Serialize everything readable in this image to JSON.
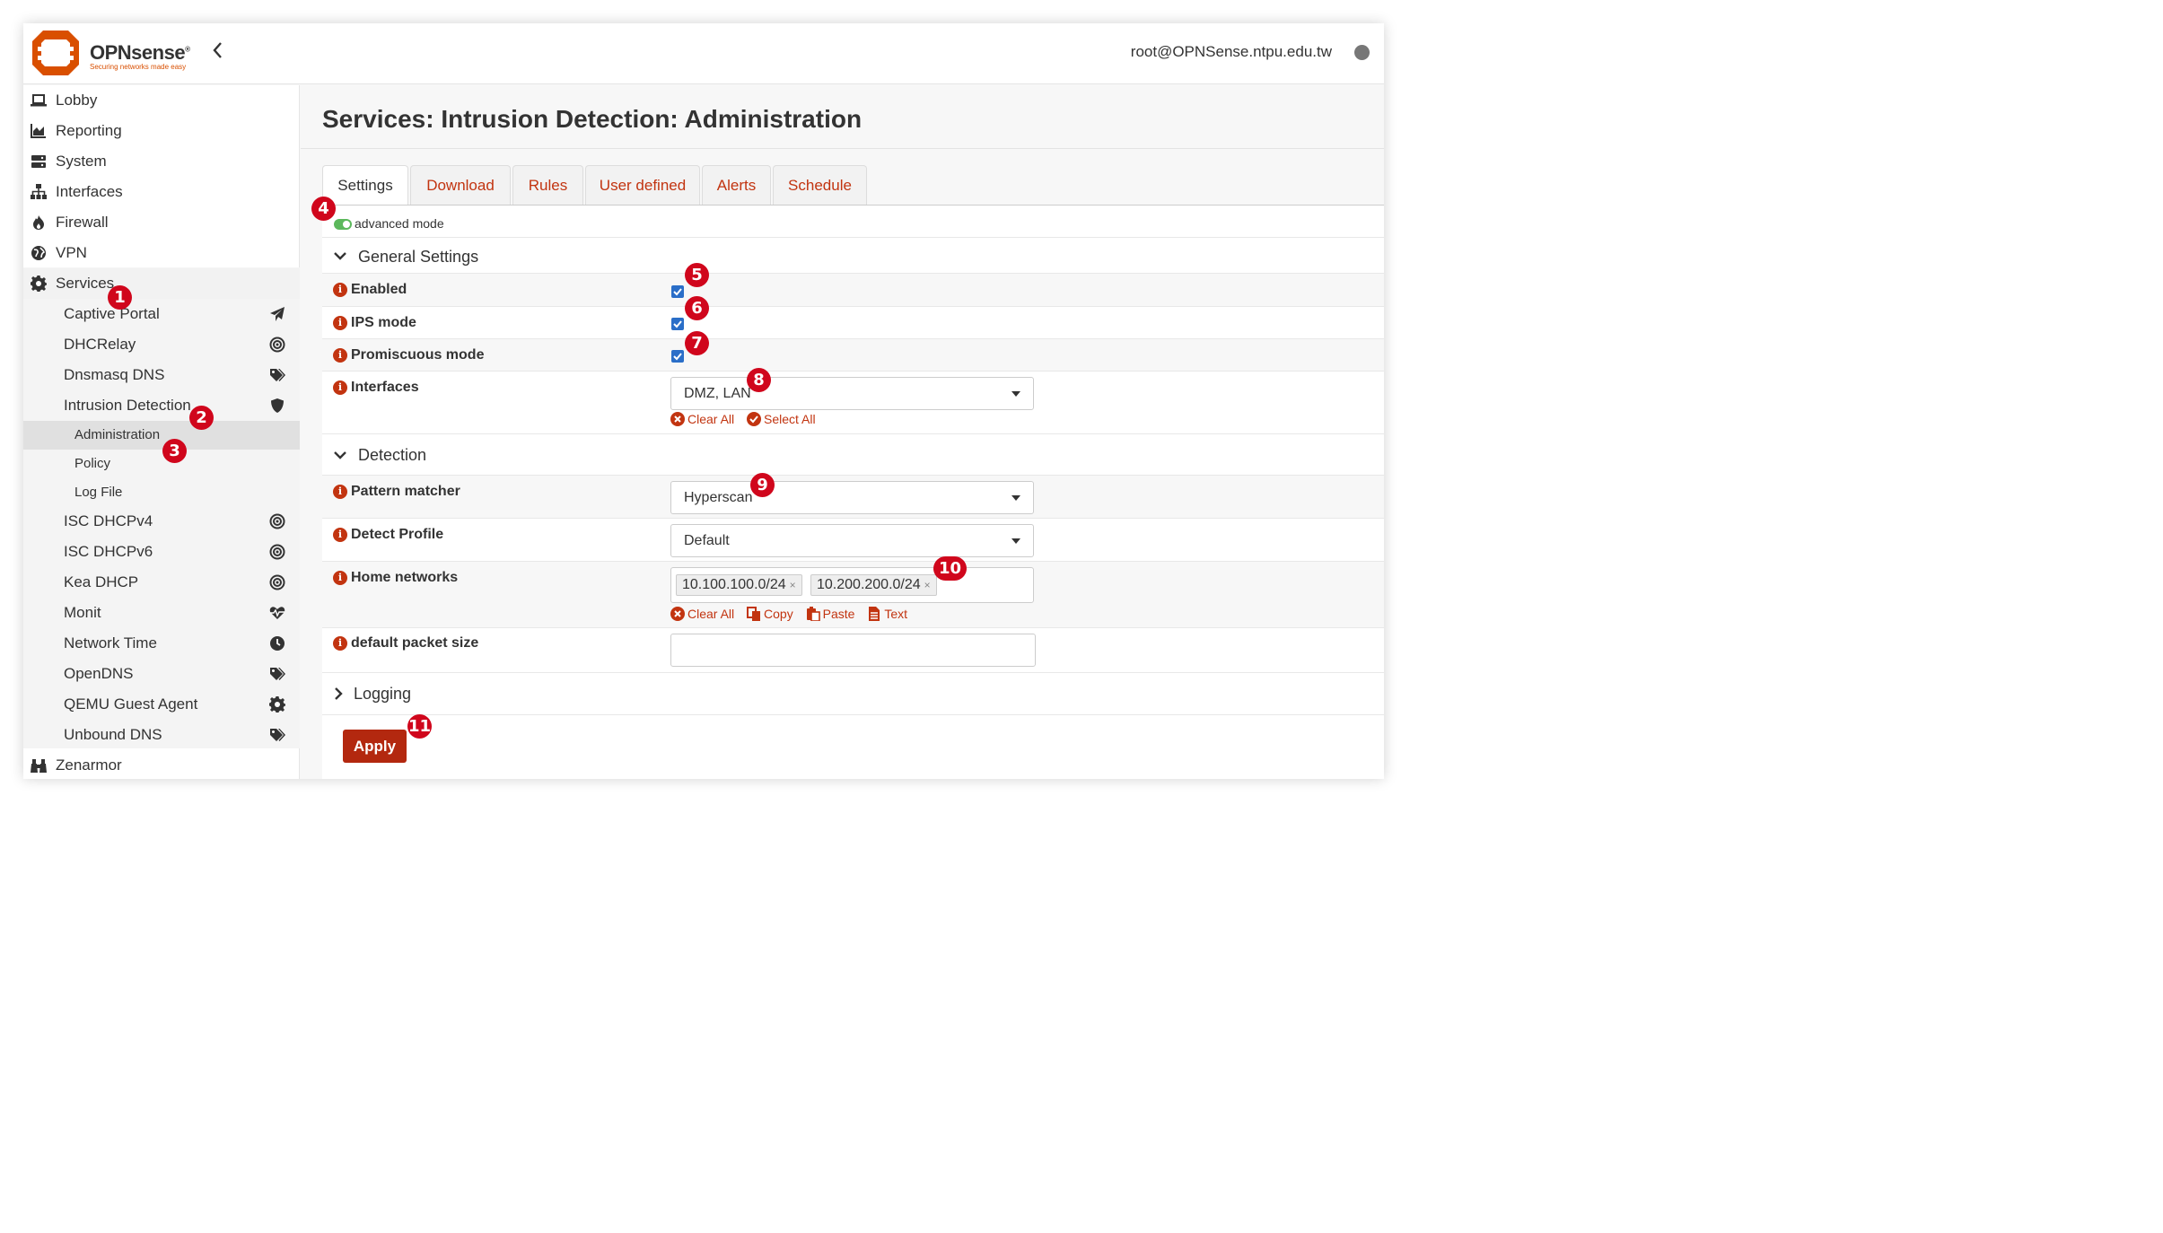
{
  "topbar": {
    "brand": "OPNsense",
    "trademark": "®",
    "tagline": "Securing networks made easy",
    "user": "root@OPNSense.ntpu.edu.tw",
    "collapse_icon": "chevron-left-icon"
  },
  "sidebar": {
    "items": [
      {
        "label": "Lobby",
        "icon": "laptop-icon"
      },
      {
        "label": "Reporting",
        "icon": "area-chart-icon"
      },
      {
        "label": "System",
        "icon": "server-icon"
      },
      {
        "label": "Interfaces",
        "icon": "sitemap-icon"
      },
      {
        "label": "Firewall",
        "icon": "fire-icon"
      },
      {
        "label": "VPN",
        "icon": "globe-icon"
      },
      {
        "label": "Services",
        "icon": "gear-icon"
      }
    ],
    "services_sub": [
      {
        "label": "Captive Portal",
        "icon": "paper-plane-icon"
      },
      {
        "label": "DHCRelay",
        "icon": "bullseye-icon"
      },
      {
        "label": "Dnsmasq DNS",
        "icon": "tags-icon"
      },
      {
        "label": "Intrusion Detection",
        "icon": "shield-icon"
      }
    ],
    "ids_leaves": [
      "Administration",
      "Policy",
      "Log File"
    ],
    "services_sub_more": [
      {
        "label": "ISC DHCPv4",
        "icon": "bullseye-icon"
      },
      {
        "label": "ISC DHCPv6",
        "icon": "bullseye-icon"
      },
      {
        "label": "Kea DHCP",
        "icon": "bullseye-icon"
      },
      {
        "label": "Monit",
        "icon": "heartbeat-icon"
      },
      {
        "label": "Network Time",
        "icon": "clock-icon"
      },
      {
        "label": "OpenDNS",
        "icon": "tags-icon"
      },
      {
        "label": "QEMU Guest Agent",
        "icon": "gear-icon"
      },
      {
        "label": "Unbound DNS",
        "icon": "tags-icon"
      }
    ],
    "zenarmor": {
      "label": "Zenarmor",
      "icon": "binoculars-icon"
    }
  },
  "page": {
    "title": "Services: Intrusion Detection: Administration",
    "tabs": [
      "Settings",
      "Download",
      "Rules",
      "User defined",
      "Alerts",
      "Schedule"
    ],
    "active_tab": "Settings",
    "advanced_mode_label": "advanced mode",
    "advanced_mode_on": true
  },
  "general": {
    "heading": "General Settings",
    "enabled_label": "Enabled",
    "enabled": true,
    "ips_label": "IPS mode",
    "ips": true,
    "promisc_label": "Promiscuous mode",
    "promisc": true,
    "interfaces_label": "Interfaces",
    "interfaces_value": "DMZ, LAN",
    "clear_all": "Clear All",
    "select_all": "Select All"
  },
  "detection": {
    "heading": "Detection",
    "pattern_label": "Pattern matcher",
    "pattern_value": "Hyperscan",
    "profile_label": "Detect Profile",
    "profile_value": "Default",
    "home_label": "Home networks",
    "home_networks": [
      "10.100.100.0/24",
      "10.200.200.0/24"
    ],
    "token_remove": "×",
    "clear_all": "Clear All",
    "copy": "Copy",
    "paste": "Paste",
    "text": "Text",
    "packet_label": "default packet size",
    "packet_value": ""
  },
  "logging": {
    "heading": "Logging"
  },
  "apply_label": "Apply",
  "annotations": [
    "1",
    "2",
    "3",
    "4",
    "5",
    "6",
    "7",
    "8",
    "9",
    "10",
    "11"
  ],
  "colors": {
    "accent": "#c23410",
    "apply": "#b3280f",
    "badge": "#d0061c",
    "toggle_on": "#5cb85c",
    "checkbox": "#2a6ec8"
  }
}
